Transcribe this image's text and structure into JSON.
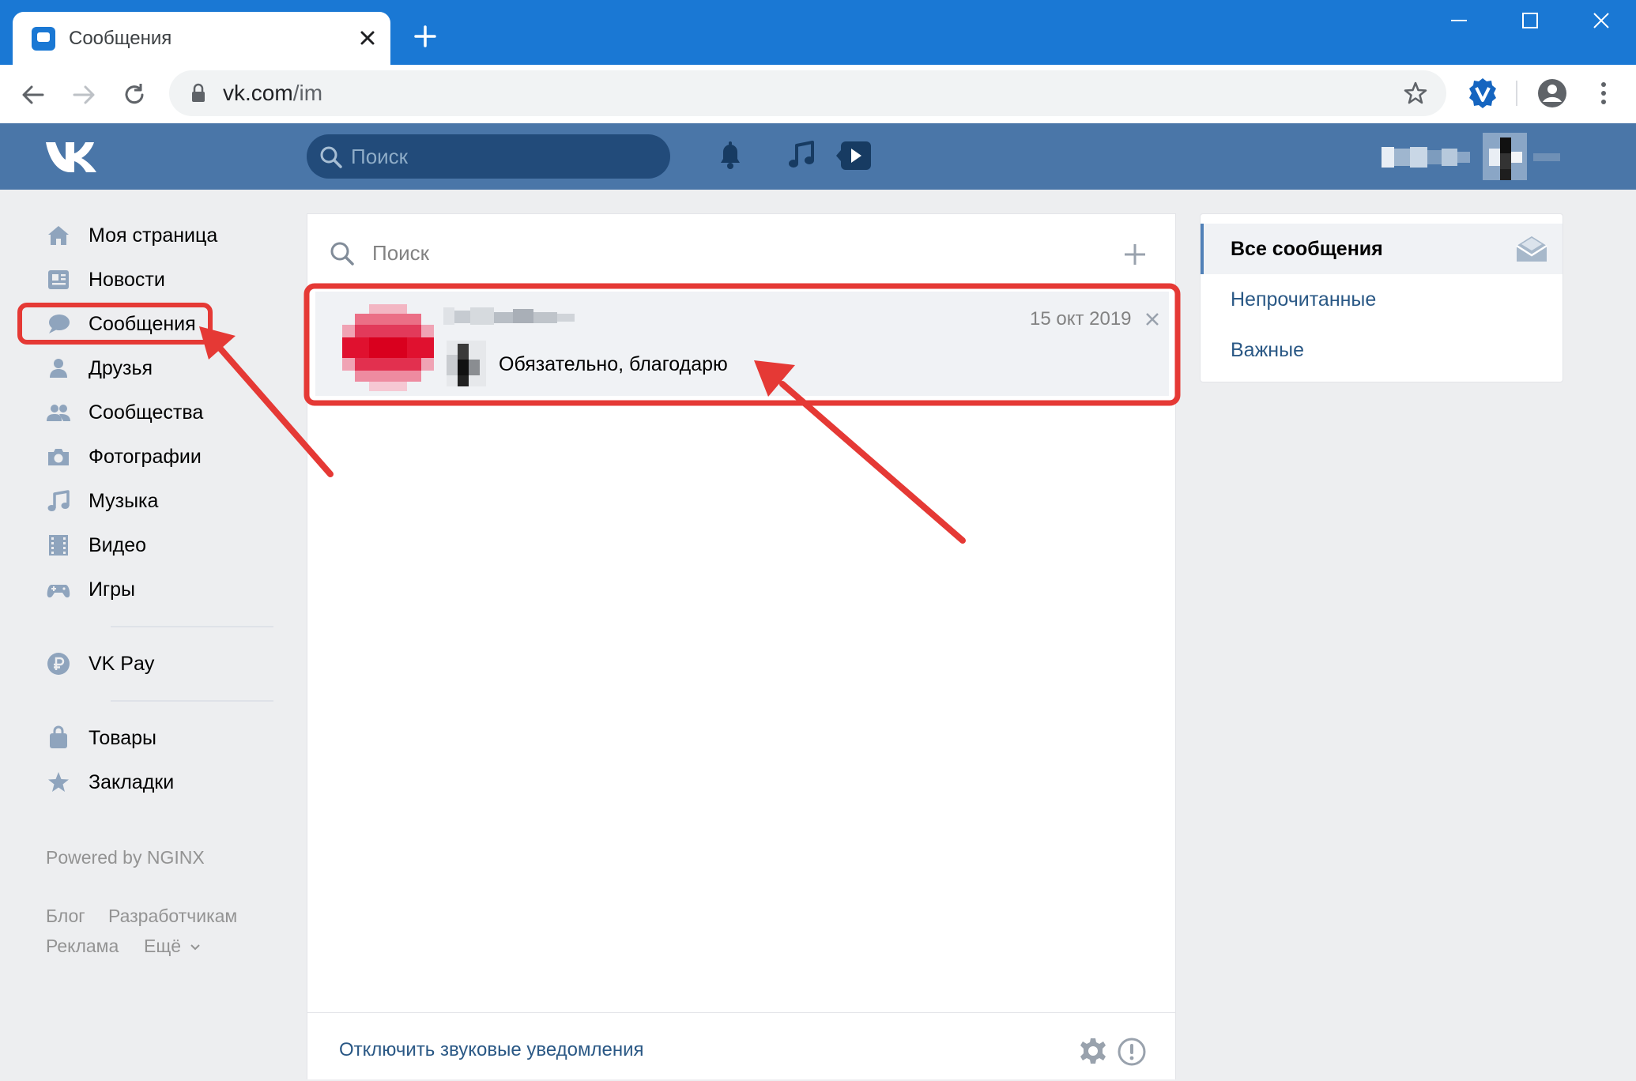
{
  "browser": {
    "tab_title": "Сообщения",
    "url_domain": "vk.com",
    "url_path": "/im",
    "titlebar_color": "#1a78d4"
  },
  "vk_header": {
    "search_placeholder": "Поиск",
    "brand_color": "#4a76a8",
    "icons": [
      "vk-logo",
      "bell-icon",
      "music-icon",
      "video-icon"
    ]
  },
  "left_menu": {
    "items": [
      {
        "label": "Моя страница",
        "icon": "home-icon"
      },
      {
        "label": "Новости",
        "icon": "news-icon"
      },
      {
        "label": "Сообщения",
        "icon": "messages-icon"
      },
      {
        "label": "Друзья",
        "icon": "friends-icon"
      },
      {
        "label": "Сообщества",
        "icon": "communities-icon"
      },
      {
        "label": "Фотографии",
        "icon": "camera-icon"
      },
      {
        "label": "Музыка",
        "icon": "music-note-icon"
      },
      {
        "label": "Видео",
        "icon": "film-icon"
      },
      {
        "label": "Игры",
        "icon": "gamepad-icon"
      }
    ],
    "pay": {
      "label": "VK Pay",
      "icon": "ruble-icon"
    },
    "extra": [
      {
        "label": "Товары",
        "icon": "bag-icon"
      },
      {
        "label": "Закладки",
        "icon": "star-icon"
      }
    ],
    "footer": {
      "powered": "Powered by NGINX",
      "links": [
        "Блог",
        "Разработчикам",
        "Реклама",
        "Ещё"
      ]
    }
  },
  "messages": {
    "search_placeholder": "Поиск",
    "dialogs": [
      {
        "date": "15 окт 2019",
        "text": "Обязательно, благодарю"
      }
    ],
    "footer_link": "Отключить звуковые уведомления"
  },
  "filters": {
    "items": [
      "Все сообщения",
      "Непрочитанные",
      "Важные"
    ],
    "active": "Все сообщения"
  },
  "annotation_color": "#e53935"
}
